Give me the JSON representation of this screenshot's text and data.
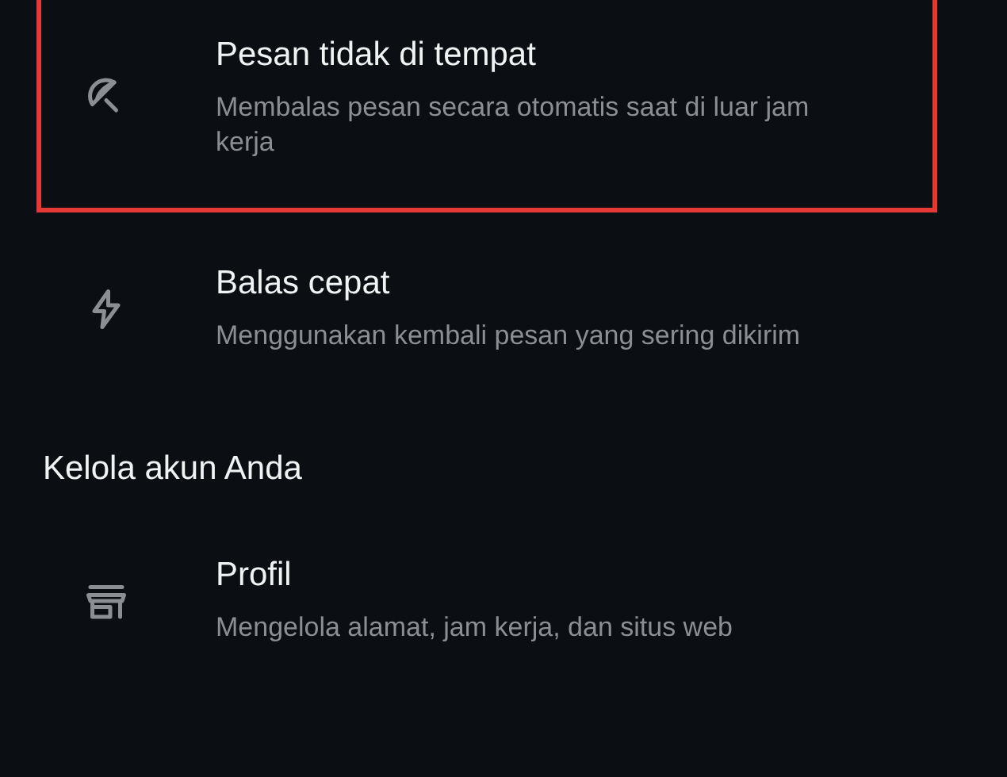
{
  "groups": [
    {
      "items": [
        {
          "kind": "umbrella",
          "title": "Pesan tidak di tempat",
          "subtitle": "Membalas pesan secara otomatis saat di luar jam kerja",
          "highlighted": true
        },
        {
          "kind": "bolt",
          "title": "Balas cepat",
          "subtitle": "Menggunakan kembali pesan yang sering dikirim",
          "highlighted": false
        }
      ]
    },
    {
      "header": "Kelola akun Anda",
      "items": [
        {
          "kind": "store",
          "title": "Profil",
          "subtitle": "Mengelola alamat, jam kerja, dan situs web",
          "highlighted": false
        }
      ]
    }
  ]
}
